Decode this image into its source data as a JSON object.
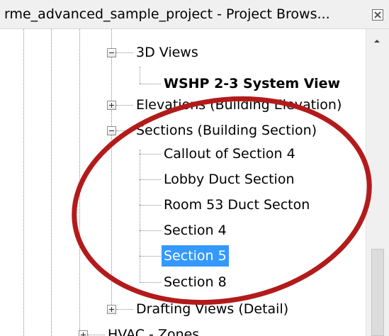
{
  "window": {
    "title": "rme_advanced_sample_project - Project Brows...",
    "close_icon": "close-icon"
  },
  "tree": {
    "views_3d": {
      "label": "3D Views",
      "expander": "minus"
    },
    "views_3d_child": {
      "label": "WSHP 2-3 System View"
    },
    "elevations": {
      "label": "Elevations (Building Elevation)",
      "expander": "plus"
    },
    "sections": {
      "label": "Sections (Building Section)",
      "expander": "minus"
    },
    "section_items": [
      {
        "label": "Callout of Section 4"
      },
      {
        "label": "Lobby Duct Section"
      },
      {
        "label": "Room 53 Duct Secton"
      },
      {
        "label": "Section 4"
      },
      {
        "label": "Section 5"
      },
      {
        "label": "Section 8"
      }
    ],
    "selected_item": "Section 5",
    "drafting": {
      "label": "Drafting Views (Detail)",
      "expander": "plus"
    },
    "hvac": {
      "label": "HVAC - Zones",
      "expander": "plus"
    }
  },
  "annotation": {
    "shape": "ellipse",
    "color": "#b31b1b"
  },
  "colors": {
    "selection": "#3399ff",
    "annotation": "#b31b1b"
  }
}
